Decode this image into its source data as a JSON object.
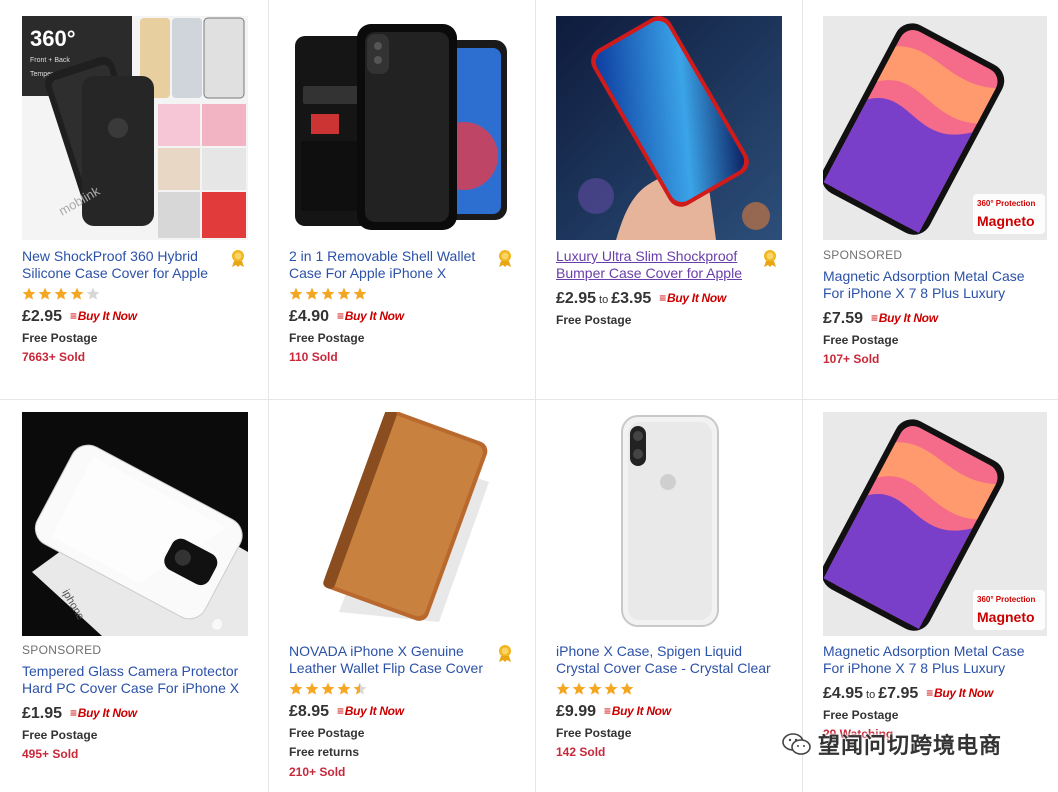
{
  "colors": {
    "link": "#2b51a8",
    "visited": "#6a3eaa",
    "star": "#f5a623",
    "sold": "#c8283a",
    "buy_it_now": "#cc0000"
  },
  "icons": {
    "medal": "top-rated-medal-icon",
    "star": "star-icon",
    "buy": "buy-it-now-logo",
    "watermark": "wechat-icon"
  },
  "buy_it_now": "Buy It Now",
  "watermark": {
    "text": "望闻问切跨境电商"
  },
  "products": [
    {
      "sponsored": "",
      "title": "New ShockProof 360 Hybrid Silicone Case Cover for Apple",
      "rating": 4,
      "price": "£2.95",
      "price_to": "",
      "to": "",
      "postage": "Free Postage",
      "returns": "",
      "sold": "7663+ Sold",
      "image": "black-360-case-collage"
    },
    {
      "sponsored": "",
      "title": "2 in 1 Removable Shell Wallet Case For Apple iPhone X",
      "rating": 5,
      "price": "£4.90",
      "price_to": "",
      "to": "",
      "postage": "Free Postage",
      "returns": "",
      "sold": "110 Sold",
      "image": "leather-wallet-case"
    },
    {
      "sponsored": "",
      "title": "Luxury Ultra Slim Shockproof Bumper Case Cover for Apple",
      "rating": 0,
      "price": "£2.95",
      "price_to": "£3.95",
      "to": "to",
      "postage": "Free Postage",
      "returns": "",
      "sold": "",
      "image": "red-bumper-case-hand"
    },
    {
      "sponsored": "SPONSORED",
      "title": "Magnetic Adsorption Metal Case For iPhone X 7 8 Plus Luxury",
      "rating": 0,
      "price": "£7.59",
      "price_to": "",
      "to": "",
      "postage": "Free Postage",
      "returns": "",
      "sold": "107+ Sold",
      "image": "magneto-case",
      "badge_line1": "360° Protection",
      "badge_line2": "Magneto"
    },
    {
      "sponsored": "SPONSORED",
      "title": "Tempered Glass Camera Protector Hard PC Cover Case For iPhone X",
      "rating": 0,
      "price": "£1.95",
      "price_to": "",
      "to": "",
      "postage": "Free Postage",
      "returns": "",
      "sold": "495+ Sold",
      "image": "white-glass-case",
      "box_text": "iphone"
    },
    {
      "sponsored": "",
      "title": "NOVADA iPhone X Genuine Leather Wallet Flip Case Cover",
      "rating": 4.5,
      "price": "£8.95",
      "price_to": "",
      "to": "",
      "postage": "Free Postage",
      "returns": "Free returns",
      "sold": "210+ Sold",
      "image": "brown-flip-case"
    },
    {
      "sponsored": "",
      "title": "iPhone X Case, Spigen Liquid Crystal Cover Case - Crystal Clear",
      "rating": 5,
      "price": "£9.99",
      "price_to": "",
      "to": "",
      "postage": "Free Postage",
      "returns": "",
      "sold": "142 Sold",
      "image": "clear-case"
    },
    {
      "sponsored": "",
      "title": "Magnetic Adsorption Metal Case For iPhone X 7 8 Plus Luxury",
      "rating": 0,
      "price": "£4.95",
      "price_to": "£7.95",
      "to": "to",
      "postage": "Free Postage",
      "returns": "",
      "sold": "29 Watching",
      "image": "magneto-case",
      "badge_line1": "360° Protection",
      "badge_line2": "Magneto"
    }
  ]
}
